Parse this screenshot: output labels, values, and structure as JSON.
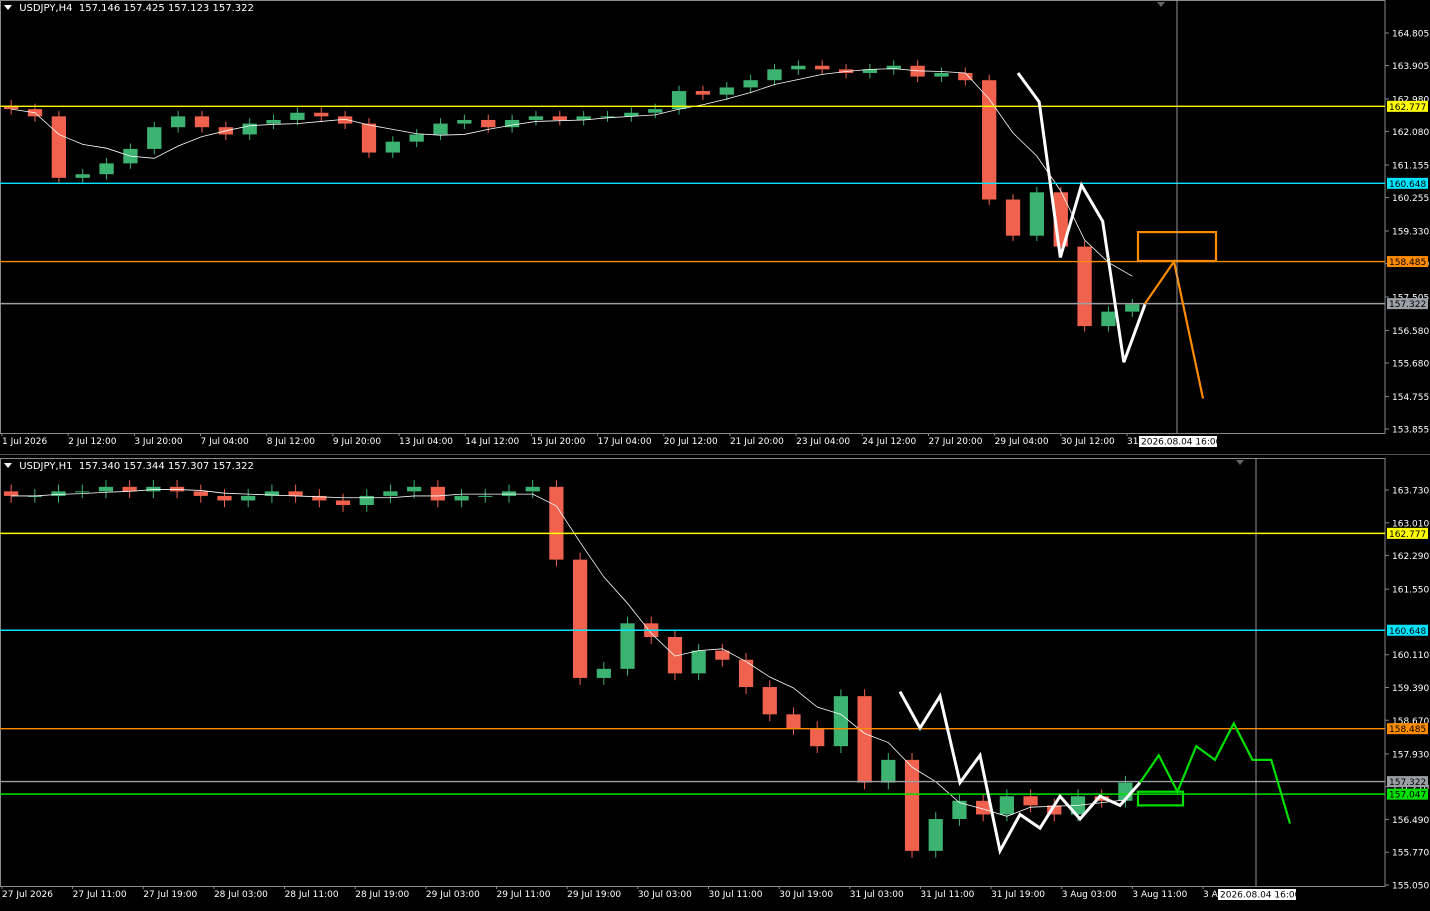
{
  "panels": [
    {
      "id": "h4",
      "header": {
        "symbol": "USDJPY,H4",
        "open": "157.146",
        "high": "157.425",
        "low": "157.123",
        "close": "157.322"
      },
      "y_ticks": [
        "164.805",
        "163.905",
        "162.980",
        "162.080",
        "161.155",
        "160.255",
        "159.330",
        "158.430",
        "157.505",
        "156.580",
        "155.680",
        "154.755",
        "153.855"
      ],
      "x_ticks": [
        "1 Jul 2026",
        "2 Jul 12:00",
        "3 Jul 20:00",
        "7 Jul 04:00",
        "8 Jul 12:00",
        "9 Jul 20:00",
        "13 Jul 04:00",
        "14 Jul 12:00",
        "15 Jul 20:00",
        "17 Jul 04:00",
        "20 Jul 12:00",
        "21 Jul 20:00",
        "23 Jul 04:00",
        "24 Jul 12:00",
        "27 Jul 20:00",
        "29 Jul 04:00",
        "30 Jul 12:00",
        "31 Jul 20:00"
      ],
      "crosshair_label": "2026.08.04 16:00",
      "levels": [
        {
          "value": "162.777",
          "color": "#ffff00"
        },
        {
          "value": "160.648",
          "color": "#00e5ff"
        },
        {
          "value": "158.485",
          "color": "#ff8c00"
        },
        {
          "value": "157.322",
          "color": "#9aa0a6"
        }
      ]
    },
    {
      "id": "h1",
      "header": {
        "symbol": "USDJPY,H1",
        "open": "157.340",
        "high": "157.344",
        "low": "157.307",
        "close": "157.322"
      },
      "y_ticks": [
        "163.730",
        "163.010",
        "162.290",
        "161.550",
        "160.110",
        "159.390",
        "158.670",
        "157.930",
        "157.210",
        "156.490",
        "155.770",
        "155.050"
      ],
      "x_ticks": [
        "27 Jul 2026",
        "27 Jul 11:00",
        "27 Jul 19:00",
        "28 Jul 03:00",
        "28 Jul 11:00",
        "28 Jul 19:00",
        "29 Jul 03:00",
        "29 Jul 11:00",
        "29 Jul 19:00",
        "30 Jul 03:00",
        "30 Jul 11:00",
        "30 Jul 19:00",
        "31 Jul 03:00",
        "31 Jul 11:00",
        "31 Jul 19:00",
        "3 Aug 03:00",
        "3 Aug 11:00",
        "3 Aug 19:00"
      ],
      "crosshair_label": "2026.08.04 16:00",
      "levels": [
        {
          "value": "162.777",
          "color": "#ffff00"
        },
        {
          "value": "160.648",
          "color": "#00e5ff"
        },
        {
          "value": "158.485",
          "color": "#ff8c00"
        },
        {
          "value": "157.322",
          "color": "#9aa0a6"
        },
        {
          "value": "157.047",
          "color": "#00e000"
        }
      ]
    }
  ],
  "colors": {
    "bull": "#3cb371",
    "bear": "#f0624d",
    "ma": "#ffffff",
    "zigzag": "#ffffff",
    "h4_projection": "#ff8c00",
    "h1_projection": "#00e000"
  },
  "chart_data": [
    {
      "type": "candlestick",
      "title": "USDJPY,H4",
      "ylim": [
        153.855,
        165.2
      ],
      "moving_average": true,
      "levels": [
        162.777,
        160.648,
        158.485,
        157.322
      ],
      "series": [
        {
          "name": "close",
          "values": [
            162.7,
            162.5,
            160.8,
            160.9,
            161.2,
            161.6,
            162.2,
            162.5,
            162.2,
            162.0,
            162.3,
            162.4,
            162.6,
            162.5,
            162.3,
            161.5,
            161.8,
            162.0,
            162.3,
            162.4,
            162.2,
            162.4,
            162.5,
            162.4,
            162.5,
            162.5,
            162.6,
            162.7,
            163.2,
            163.1,
            163.3,
            163.5,
            163.8,
            163.9,
            163.8,
            163.7,
            163.8,
            163.9,
            163.6,
            163.7,
            163.5,
            160.2,
            159.2,
            160.4,
            158.9,
            156.7,
            157.1,
            157.3
          ]
        }
      ],
      "zigzag": [
        [
          163.7,
          0
        ],
        [
          162.9,
          0
        ],
        [
          158.6,
          0
        ],
        [
          160.6,
          0
        ],
        [
          159.6,
          0
        ],
        [
          155.7,
          0
        ],
        [
          157.3,
          0
        ]
      ],
      "projection": [
        157.322,
        158.485,
        154.7
      ],
      "target_zone": [
        158.5,
        159.3
      ]
    },
    {
      "type": "candlestick",
      "title": "USDJPY,H1",
      "ylim": [
        155.05,
        164.2
      ],
      "moving_average": true,
      "levels": [
        162.777,
        160.648,
        158.485,
        157.322,
        157.047
      ],
      "series": [
        {
          "name": "close",
          "values": [
            163.6,
            163.6,
            163.7,
            163.7,
            163.8,
            163.7,
            163.8,
            163.7,
            163.6,
            163.5,
            163.6,
            163.7,
            163.6,
            163.5,
            163.4,
            163.6,
            163.7,
            163.8,
            163.5,
            163.6,
            163.6,
            163.7,
            163.8,
            162.2,
            159.6,
            159.8,
            160.8,
            160.5,
            159.7,
            160.2,
            160.0,
            159.4,
            158.8,
            158.5,
            158.1,
            159.2,
            157.3,
            157.8,
            155.8,
            156.5,
            156.9,
            156.6,
            157.0,
            156.8,
            156.6,
            157.0,
            156.9,
            157.3
          ]
        }
      ],
      "zigzag": [
        159.3,
        158.5,
        159.2,
        157.3,
        157.9,
        155.8,
        156.6,
        156.3,
        157.0,
        156.5,
        157.0,
        156.8,
        157.3
      ],
      "projection": [
        157.3,
        157.9,
        157.1,
        158.1,
        157.8,
        158.6,
        157.8,
        157.8,
        156.4
      ],
      "target_zone": [
        156.8,
        157.1
      ]
    }
  ]
}
